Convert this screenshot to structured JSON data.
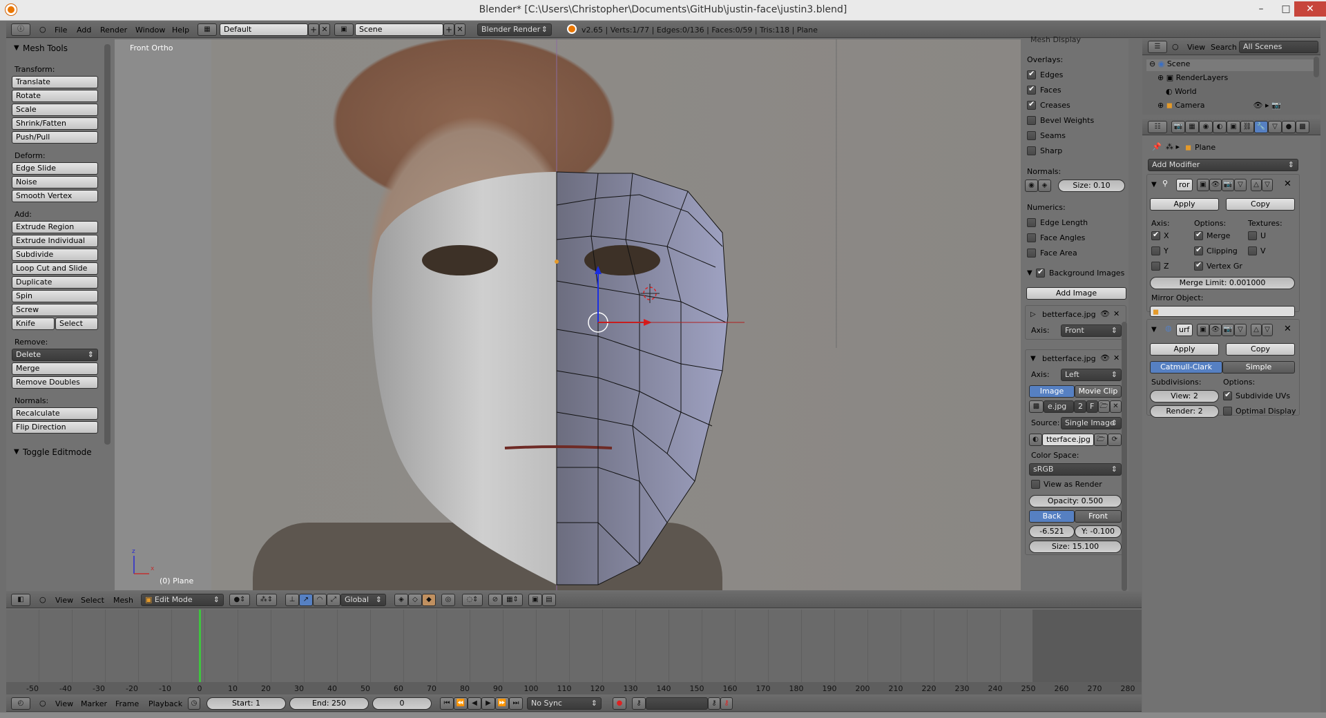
{
  "window": {
    "title": "Blender* [C:\\Users\\Christopher\\Documents\\GitHub\\justin-face\\justin3.blend]",
    "minimize": "–",
    "maximize": "□",
    "close": "✕"
  },
  "info_header": {
    "menus": [
      "File",
      "Add",
      "Render",
      "Window",
      "Help"
    ],
    "layout": "Default",
    "scene": "Scene",
    "engine": "Blender Render",
    "stats": "v2.65 | Verts:1/77 | Edges:0/136 | Faces:0/59 | Tris:118 | Plane"
  },
  "tool_shelf": {
    "title": "Mesh Tools",
    "transform_label": "Transform:",
    "transform": [
      "Translate",
      "Rotate",
      "Scale",
      "Shrink/Fatten",
      "Push/Pull"
    ],
    "deform_label": "Deform:",
    "deform": [
      "Edge Slide",
      "Noise",
      "Smooth Vertex"
    ],
    "add_label": "Add:",
    "add": [
      "Extrude Region",
      "Extrude Individual",
      "Subdivide",
      "Loop Cut and Slide",
      "Duplicate",
      "Spin",
      "Screw"
    ],
    "knife": "Knife",
    "select": "Select",
    "remove_label": "Remove:",
    "delete": "Delete",
    "remove": [
      "Merge",
      "Remove Doubles"
    ],
    "normals_label": "Normals:",
    "normals": [
      "Recalculate",
      "Flip Direction"
    ],
    "toggle": "Toggle Editmode"
  },
  "viewport": {
    "view_label": "Front Ortho",
    "object_label": "(0) Plane"
  },
  "properties_panel": {
    "section_top": "Mesh Display",
    "overlays_label": "Overlays:",
    "overlays": [
      {
        "label": "Edges",
        "checked": true
      },
      {
        "label": "Faces",
        "checked": true
      },
      {
        "label": "Creases",
        "checked": true
      },
      {
        "label": "Bevel Weights",
        "checked": false
      },
      {
        "label": "Seams",
        "checked": false
      },
      {
        "label": "Sharp",
        "checked": false
      }
    ],
    "normals_label": "Normals:",
    "normals_size": "Size: 0.10",
    "numerics_label": "Numerics:",
    "numerics": [
      {
        "label": "Edge Length",
        "checked": false
      },
      {
        "label": "Face Angles",
        "checked": false
      },
      {
        "label": "Face Area",
        "checked": false
      }
    ],
    "bg_images_title": "Background Images",
    "add_image": "Add Image",
    "img1": {
      "name": "betterface.jpg",
      "axis_label": "Axis:",
      "axis": "Front"
    },
    "img2": {
      "name": "betterface.jpg",
      "axis_label": "Axis:",
      "axis": "Left",
      "tab_image": "Image",
      "tab_clip": "Movie Clip",
      "file": "e.jpg",
      "users": "2",
      "fake": "F",
      "source_label": "Source:",
      "source": "Single Image",
      "path": "tterface.jpg",
      "colorspace_label": "Color Space:",
      "colorspace": "sRGB",
      "view_as_render": "View as Render",
      "opacity": "Opacity: 0.500",
      "back": "Back",
      "front": "Front",
      "x": "-6.521",
      "y": "Y: -0.100",
      "size": "Size: 15.100"
    }
  },
  "viewport_header": {
    "menus": [
      "View",
      "Select",
      "Mesh"
    ],
    "mode": "Edit Mode",
    "orientation": "Global"
  },
  "outliner": {
    "menus": [
      "View",
      "Search"
    ],
    "filter": "All Scenes",
    "rows": [
      "Scene",
      "RenderLayers",
      "World",
      "Camera"
    ]
  },
  "modifiers": {
    "breadcrumb": "Plane",
    "add_modifier": "Add Modifier",
    "mirror": {
      "name": "ror",
      "apply": "Apply",
      "copy": "Copy",
      "axis_label": "Axis:",
      "options_label": "Options:",
      "textures_label": "Textures:",
      "axes": [
        {
          "label": "X",
          "checked": true
        },
        {
          "label": "Y",
          "checked": false
        },
        {
          "label": "Z",
          "checked": false
        }
      ],
      "options": [
        {
          "label": "Merge",
          "checked": true
        },
        {
          "label": "Clipping",
          "checked": true
        },
        {
          "label": "Vertex Gr",
          "checked": true
        }
      ],
      "textures": [
        {
          "label": "U",
          "checked": false
        },
        {
          "label": "V",
          "checked": false
        }
      ],
      "merge_limit": "Merge Limit: 0.001000",
      "mirror_object_label": "Mirror Object:"
    },
    "subsurf": {
      "name": "urf",
      "apply": "Apply",
      "copy": "Copy",
      "catmull": "Catmull-Clark",
      "simple": "Simple",
      "subdiv_label": "Subdivisions:",
      "options_label": "Options:",
      "view": "View: 2",
      "render": "Render: 2",
      "subdivide_uvs": {
        "label": "Subdivide UVs",
        "checked": true
      },
      "optimal_display": {
        "label": "Optimal Display",
        "checked": false
      }
    }
  },
  "timeline": {
    "ticks": [
      "-50",
      "-40",
      "-30",
      "-20",
      "-10",
      "0",
      "10",
      "20",
      "30",
      "40",
      "50",
      "60",
      "70",
      "80",
      "90",
      "100",
      "110",
      "120",
      "130",
      "140",
      "150",
      "160",
      "170",
      "180",
      "190",
      "200",
      "210",
      "220",
      "230",
      "240",
      "250",
      "260",
      "270",
      "280"
    ],
    "menus": [
      "View",
      "Marker",
      "Frame",
      "Playback"
    ],
    "start": "Start: 1",
    "end": "End: 250",
    "current": "0",
    "sync": "No Sync"
  }
}
